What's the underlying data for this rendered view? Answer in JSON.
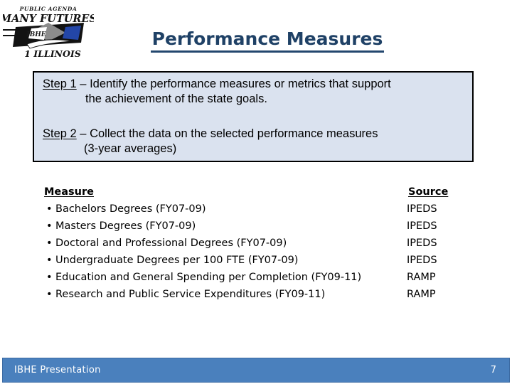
{
  "logo": {
    "line_top": "PUBLIC AGENDA",
    "line_main": "MANY FUTURES",
    "line_bottom": "1 ILLINOIS",
    "mark_text": "IBHE",
    "colors": {
      "band": "#111111",
      "diamond_gray": "#8c8c8c",
      "diamond_blue": "#2346a8",
      "text": "#1a1a1a"
    }
  },
  "title": {
    "text": "Performance Measures",
    "color": "#1f4166"
  },
  "steps": {
    "step1": {
      "label": "Step 1",
      "line1": " – Identify the performance measures or metrics that support",
      "line2": "the achievement of the state goals."
    },
    "step2": {
      "label": "Step 2",
      "line1": " – Collect the data on the selected performance measures",
      "line2": "(3-year averages)"
    },
    "box_fill": "#dae2ef",
    "box_border": "#000000"
  },
  "measures": {
    "headers": {
      "measure": "Measure",
      "source": "Source"
    },
    "bullet": "•",
    "rows": [
      {
        "measure": "Bachelors Degrees (FY07-09)",
        "source": "IPEDS"
      },
      {
        "measure": "Masters Degrees (FY07-09)",
        "source": "IPEDS"
      },
      {
        "measure": "Doctoral and Professional Degrees (FY07-09)",
        "source": "IPEDS"
      },
      {
        "measure": "Undergraduate Degrees per 100 FTE (FY07-09)",
        "source": "IPEDS"
      },
      {
        "measure": "Education and General Spending per Completion (FY09-11)",
        "source": "RAMP"
      },
      {
        "measure": "Research and Public Service Expenditures (FY09-11)",
        "source": "RAMP"
      }
    ]
  },
  "footer": {
    "text": "IBHE Presentation",
    "page_number": "7",
    "bar_color": "#4a80bd",
    "text_color": "#ffffff"
  }
}
